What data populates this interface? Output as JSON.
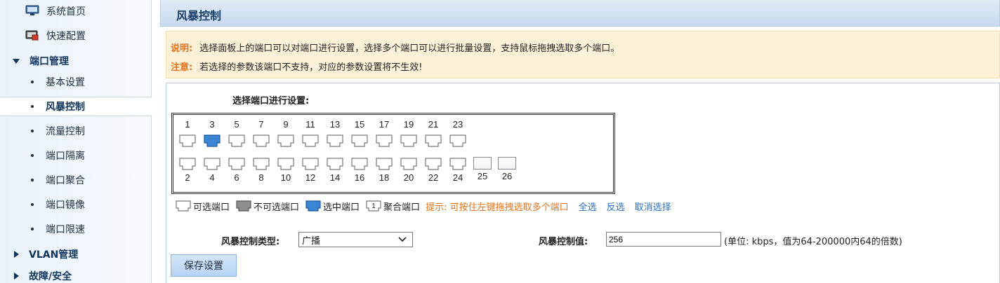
{
  "sidebar": {
    "home": "系统首页",
    "quick_config": "快速配置",
    "port_mgmt": "端口管理",
    "items": [
      {
        "label": "基本设置"
      },
      {
        "label": "风暴控制"
      },
      {
        "label": "流量控制"
      },
      {
        "label": "端口隔离"
      },
      {
        "label": "端口聚合"
      },
      {
        "label": "端口镜像"
      },
      {
        "label": "端口限速"
      }
    ],
    "vlan_mgmt": "VLAN管理",
    "fault_security": "故障/安全"
  },
  "page": {
    "title": "风暴控制"
  },
  "notice": {
    "explain_tag": "说明:",
    "explain_text": "选择面板上的端口可以对端口进行设置，选择多个端口可以进行批量设置，支持鼠标拖拽选取多个端口。",
    "attention_tag": "注意:",
    "attention_text": "若选择的参数该端口不支持，对应的参数设置将不生效!"
  },
  "panel": {
    "select_title": "选择端口进行设置:",
    "top_ports": [
      "1",
      "3",
      "5",
      "7",
      "9",
      "11",
      "13",
      "15",
      "17",
      "19",
      "21",
      "23"
    ],
    "bottom_ports": [
      "2",
      "4",
      "6",
      "8",
      "10",
      "12",
      "14",
      "16",
      "18",
      "20",
      "22",
      "24"
    ],
    "fiber_ports": [
      "25",
      "26"
    ],
    "selected_port": "3"
  },
  "legend": {
    "selectable": "可选端口",
    "unselectable": "不可选端口",
    "selected": "选中端口",
    "aggregated_icon_num": "1",
    "aggregated": "聚合端口",
    "hint": "提示: 可按住左键拖拽选取多个端口",
    "select_all": "全选",
    "invert": "反选",
    "cancel": "取消选择"
  },
  "storm": {
    "type_label": "风暴控制类型:",
    "type_value": "广播",
    "value_label": "风暴控制值:",
    "value": "256",
    "unit_text": "(单位: kbps，值为64-200000内64的倍数)"
  },
  "save_label": "保存设置",
  "colors": {
    "accent": "#2a6fbf",
    "hint_orange": "#e2731c",
    "selected_port": "#3a86d4"
  }
}
